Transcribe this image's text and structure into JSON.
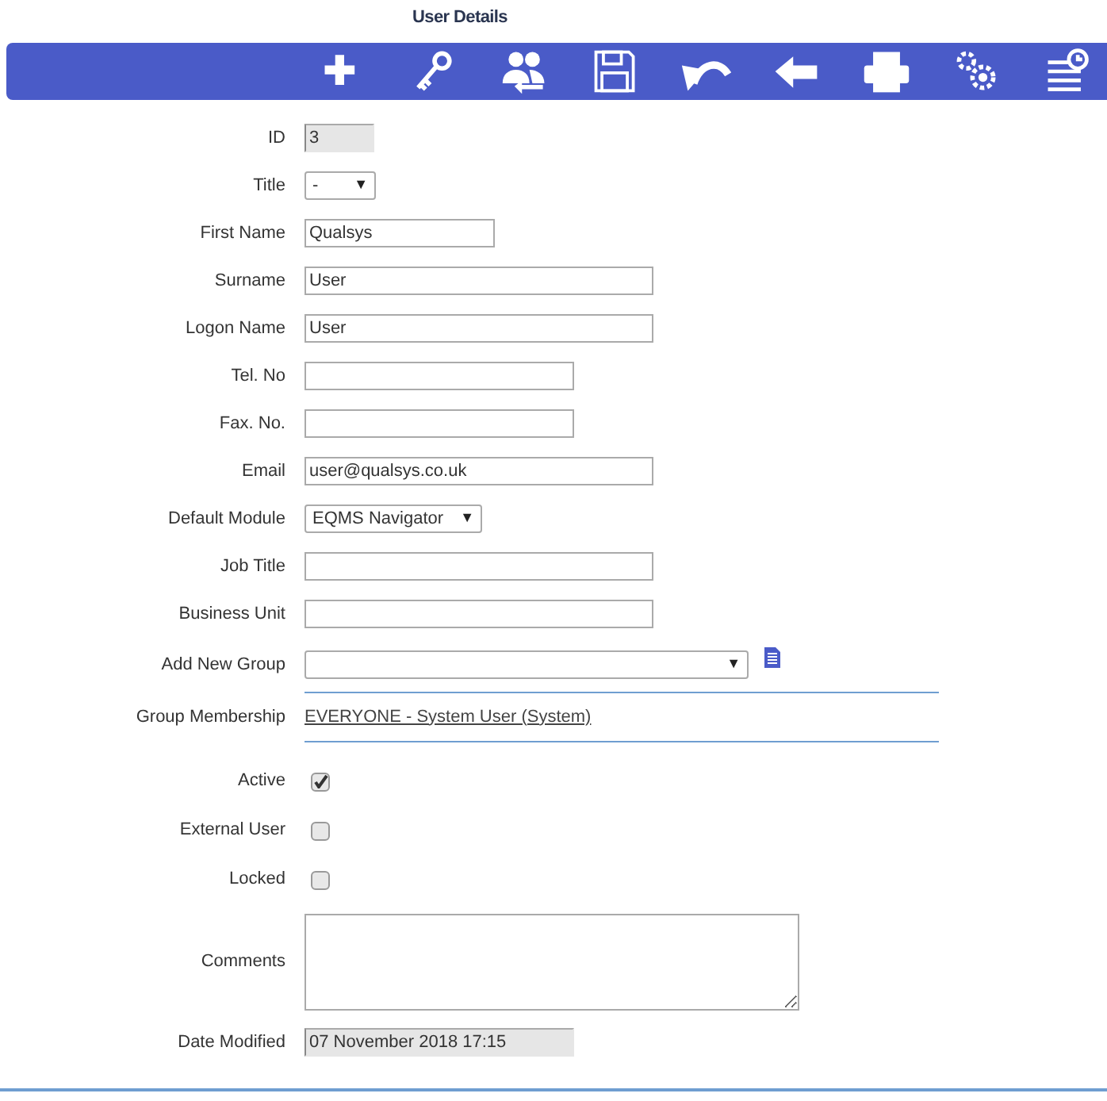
{
  "page_title": "User Details",
  "fields": [
    {
      "label": "ID",
      "kind": "readonly",
      "value": "3"
    },
    {
      "label": "Title",
      "kind": "select",
      "value": "-",
      "arrow": "▼"
    },
    {
      "label": "First Name",
      "kind": "text",
      "value": "Qualsys"
    },
    {
      "label": "Surname",
      "kind": "text",
      "value": "User"
    },
    {
      "label": "Logon Name",
      "kind": "text",
      "value": "User"
    },
    {
      "label": "Tel. No",
      "kind": "text"
    },
    {
      "label": "Fax. No.",
      "kind": "text"
    },
    {
      "label": "Email",
      "kind": "text",
      "value": "user@qualsys.co.uk"
    },
    {
      "label": "Default Module",
      "kind": "select",
      "value": "EQMS Navigator",
      "arrow": "▼"
    },
    {
      "label": "Job Title",
      "kind": "text"
    },
    {
      "label": "Business Unit",
      "kind": "text"
    },
    {
      "label": "Add New Group",
      "kind": "groupselect",
      "arrow": "▼"
    },
    {
      "label": "Group Membership",
      "kind": "links",
      "links": [
        "EVERYONE - System User (System)"
      ]
    },
    {
      "label": "Active",
      "kind": "checkbox",
      "checked": true
    },
    {
      "label": "External User",
      "kind": "checkbox",
      "checked": false
    },
    {
      "label": "Locked",
      "kind": "checkbox",
      "checked": false
    },
    {
      "label": "Comments",
      "kind": "textarea"
    },
    {
      "label": "Date Modified",
      "kind": "readonly",
      "value": "07 November 2018 17:15"
    }
  ]
}
